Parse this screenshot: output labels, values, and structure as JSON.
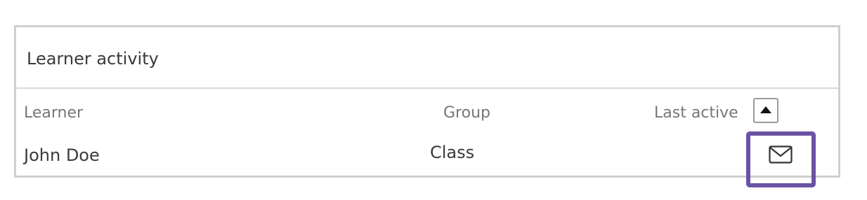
{
  "panel": {
    "title": "Learner activity"
  },
  "table": {
    "columns": {
      "learner": "Learner",
      "group": "Group",
      "last_active": "Last active"
    },
    "sort": {
      "icon": "caret-up-icon",
      "direction": "ascending"
    },
    "rows": [
      {
        "learner": "John Doe",
        "group": "Class",
        "action_icon": "envelope-icon"
      }
    ]
  },
  "colors": {
    "highlight": "#6b52a3",
    "border": "#cfcfcf",
    "header_text": "#777777",
    "body_text": "#3a3a3a"
  }
}
